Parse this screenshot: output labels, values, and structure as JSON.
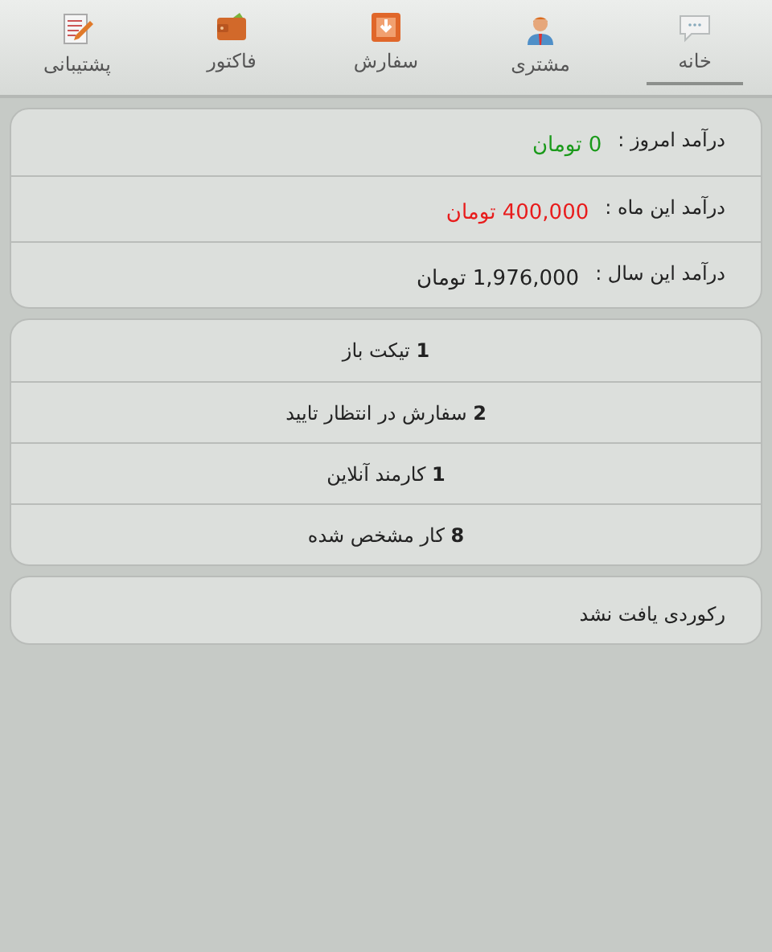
{
  "tabs": [
    {
      "label": "خانه",
      "kind": "chat",
      "selected": true
    },
    {
      "label": "مشتری",
      "kind": "person",
      "selected": false
    },
    {
      "label": "سفارش",
      "kind": "box",
      "selected": false
    },
    {
      "label": "فاکتور",
      "kind": "wallet",
      "selected": false
    },
    {
      "label": "پشتیبانی",
      "kind": "notepad",
      "selected": false
    }
  ],
  "income": [
    {
      "label": "درآمد امروز :",
      "value": "0 تومان",
      "color": "#1a9a1a"
    },
    {
      "label": "درآمد این ماه :",
      "value": "400,000 تومان",
      "color": "#e81c1c"
    },
    {
      "label": "درآمد این سال :",
      "value": "1,976,000 تومان",
      "color": "#222222"
    }
  ],
  "stats": [
    "**1** تیکت باز",
    "**2** سفارش در انتظار تایید",
    "**1** کارمند آنلاین",
    "**8** کار مشخص شده"
  ],
  "notice": "رکوردی یافت نشد"
}
